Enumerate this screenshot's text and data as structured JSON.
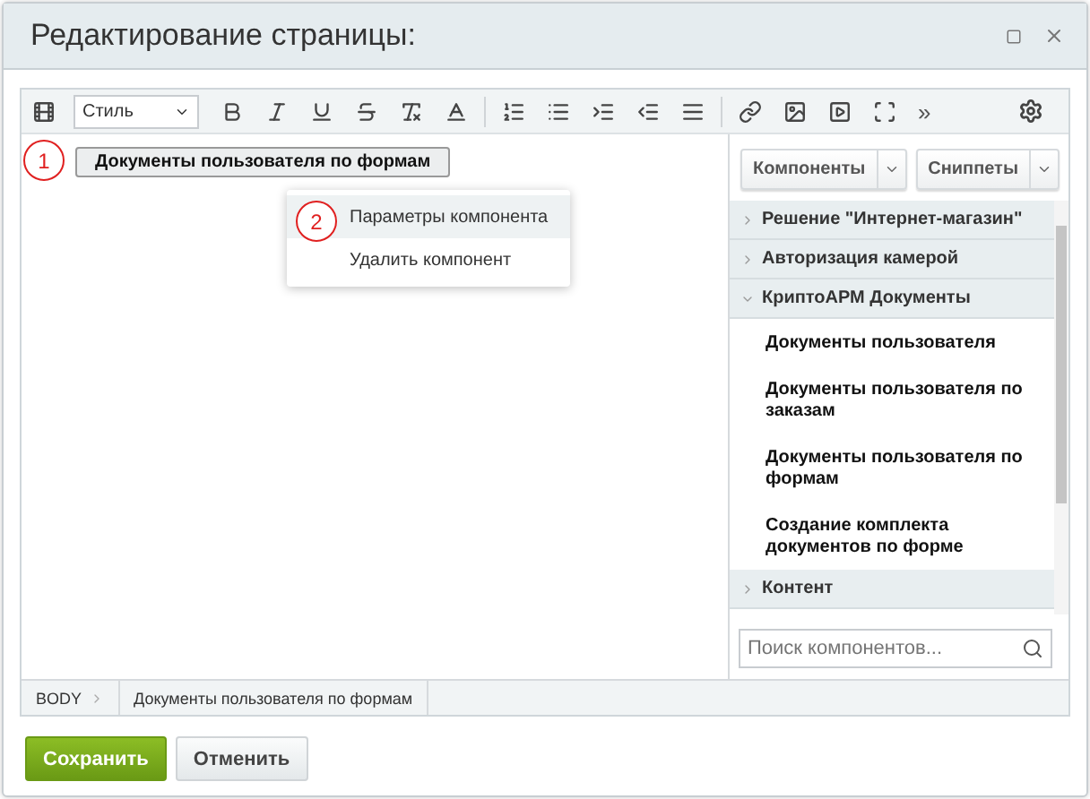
{
  "window": {
    "title": "Редактирование страницы:"
  },
  "toolbar": {
    "style_select": "Стиль",
    "more": "»"
  },
  "editor": {
    "component_label": "Документы пользователя по формам",
    "callouts": [
      "1",
      "2"
    ],
    "context_menu": [
      {
        "label": "Параметры компонента",
        "selected": true
      },
      {
        "label": "Удалить компонент",
        "selected": false
      }
    ]
  },
  "panel": {
    "tabs": [
      {
        "label": "Компоненты"
      },
      {
        "label": "Сниппеты"
      }
    ],
    "groups": [
      {
        "label": "Решение \"Интернет-магазин\"",
        "expanded": false
      },
      {
        "label": "Авторизация камерой",
        "expanded": false
      },
      {
        "label": "КриптоАРМ Документы",
        "expanded": true,
        "children": [
          {
            "label": "Документы пользователя"
          },
          {
            "label": "Документы пользователя по заказам"
          },
          {
            "label": "Документы пользователя по формам"
          },
          {
            "label": "Создание комплекта документов по форме"
          }
        ]
      },
      {
        "label": "Контент",
        "expanded": false
      }
    ],
    "search": {
      "placeholder": "Поиск компонентов..."
    }
  },
  "status_bar": {
    "path": [
      "BODY",
      "Документы пользователя по формам"
    ]
  },
  "buttons": [
    {
      "label": "Сохранить",
      "kind": "primary"
    },
    {
      "label": "Отменить",
      "kind": "secondary"
    }
  ]
}
